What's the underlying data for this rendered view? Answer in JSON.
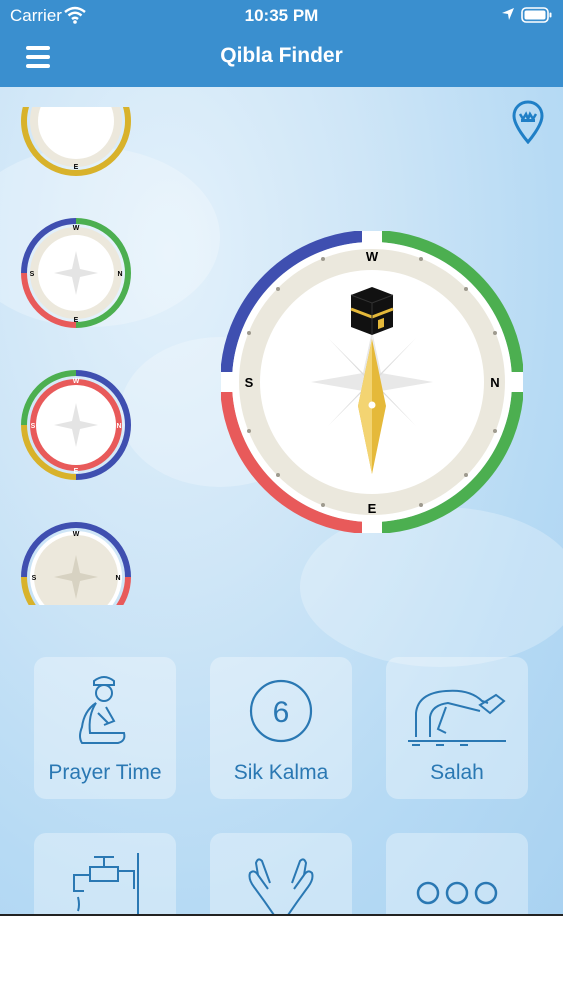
{
  "status_bar": {
    "carrier": "Carrier",
    "time": "10:35 PM"
  },
  "nav": {
    "title": "Qibla Finder"
  },
  "compass": {
    "n": "N",
    "s": "S",
    "e": "E",
    "w": "W"
  },
  "icons": {
    "menu": "hamburger-icon",
    "location": "map-pin-icon",
    "kaaba": "kaaba-icon"
  },
  "colors": {
    "nav_bg": "#3a8fcf",
    "ring_blue": "#3f4fb0",
    "ring_green": "#4caf50",
    "ring_red": "#e85a5a",
    "ring_yellow": "#d8b22b",
    "card_text": "#2a78b3"
  },
  "features": [
    {
      "label": "Prayer Time",
      "icon": "praying-man-icon"
    },
    {
      "label": "Sik Kalma",
      "icon": "number-six-circle-icon",
      "icon_text": "6"
    },
    {
      "label": "Salah",
      "icon": "prostrating-man-icon"
    },
    {
      "label": "",
      "icon": "wudu-tap-icon"
    },
    {
      "label": "",
      "icon": "dua-hands-icon"
    },
    {
      "label": "",
      "icon": "more-dots-icon"
    }
  ]
}
